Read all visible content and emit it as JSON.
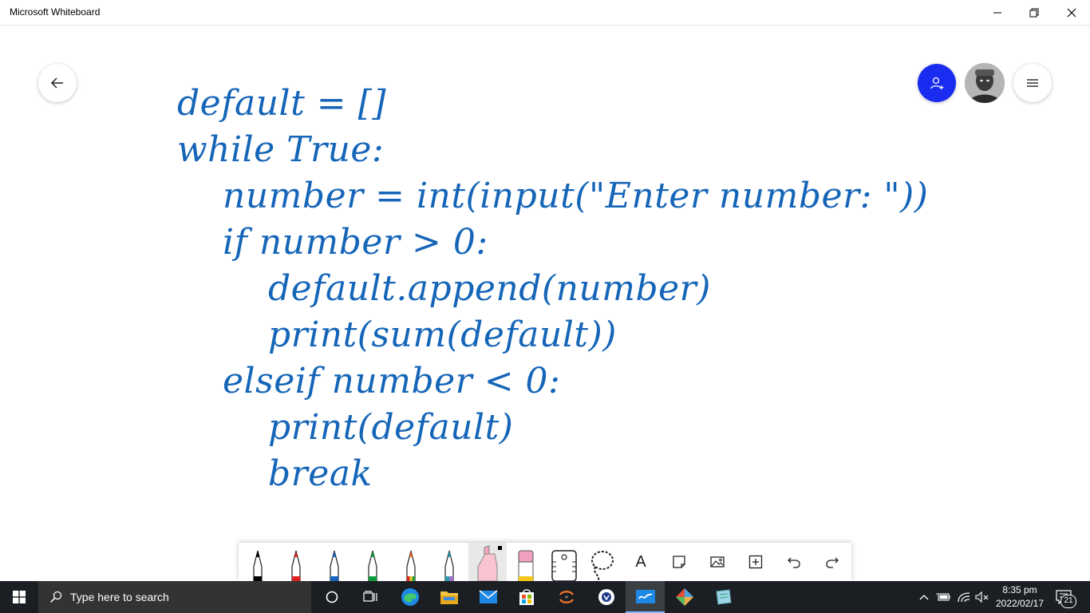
{
  "window": {
    "title": "Microsoft Whiteboard"
  },
  "icons": {
    "back": "arrow-left-icon",
    "invite": "add-person-icon",
    "menu": "hamburger-menu-icon",
    "minimize": "minimize-icon",
    "restore": "restore-icon",
    "close": "close-icon"
  },
  "board": {
    "ink_color": "#1565b8",
    "lines": [
      "default = []",
      "while True:",
      "number = int(input(\"Enter number: \"))",
      "if number > 0:",
      "default.append(number)",
      "print(sum(default))",
      "elseif number < 0:",
      "print(default)",
      "break"
    ]
  },
  "toolbar": {
    "tools": [
      {
        "name": "pen-black",
        "color": "#000000"
      },
      {
        "name": "pen-red",
        "color": "#e02020"
      },
      {
        "name": "pen-blue",
        "color": "#1565c0"
      },
      {
        "name": "pen-green",
        "color": "#0a9e3c"
      },
      {
        "name": "pen-rainbow",
        "color": "#e86a20"
      },
      {
        "name": "pen-galaxy",
        "color": "#2a9da8"
      },
      {
        "name": "highlighter",
        "color": "#f4a6b8"
      },
      {
        "name": "eraser",
        "color": "#f2a0c0"
      },
      {
        "name": "ruler",
        "color": "#000000"
      },
      {
        "name": "lasso",
        "color": "#000000"
      },
      {
        "name": "text",
        "color": "#000000"
      },
      {
        "name": "note",
        "color": "#000000"
      },
      {
        "name": "image",
        "color": "#000000"
      },
      {
        "name": "insert",
        "color": "#000000"
      },
      {
        "name": "undo",
        "color": "#000000"
      },
      {
        "name": "redo",
        "color": "#000000"
      }
    ],
    "text_tool_label": "A"
  },
  "taskbar": {
    "search_placeholder": "Type here to search",
    "time": "8:35 pm",
    "date": "2022/02/17",
    "notifications": "21"
  }
}
